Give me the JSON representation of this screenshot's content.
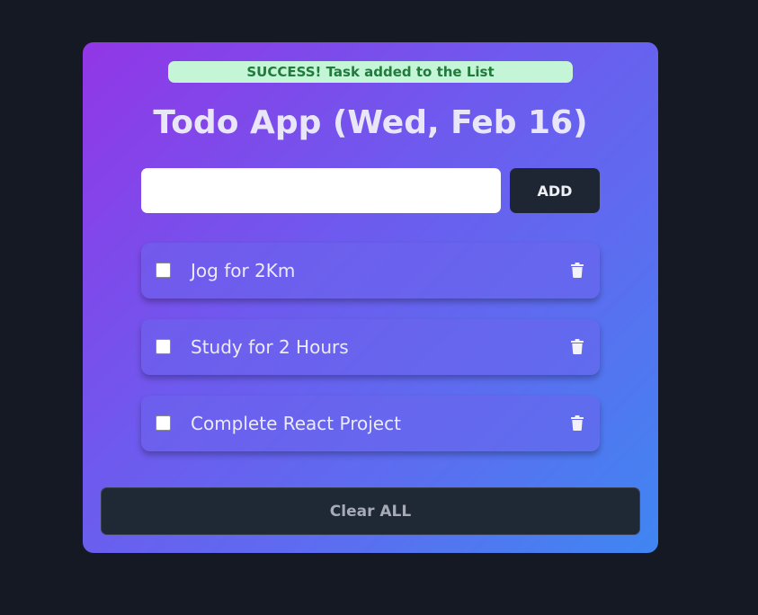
{
  "alert": {
    "text": "SUCCESS! Task added to the List",
    "background": "#c4f5d6",
    "color": "#1f7a3b"
  },
  "header": {
    "title": "Todo App (Wed, Feb 16)"
  },
  "form": {
    "input_value": "",
    "add_label": "ADD"
  },
  "todos": [
    {
      "label": "Jog for 2Km",
      "checked": false,
      "icon": "trash-icon"
    },
    {
      "label": "Study for 2 Hours",
      "checked": false,
      "icon": "trash-icon"
    },
    {
      "label": "Complete React Project",
      "checked": false,
      "icon": "trash-icon"
    }
  ],
  "footer": {
    "clear_label": "Clear ALL"
  },
  "colors": {
    "page_background": "#141923",
    "gradient_start": "#9236e6",
    "gradient_end": "#3f86f1",
    "button_dark": "#1f2633"
  }
}
